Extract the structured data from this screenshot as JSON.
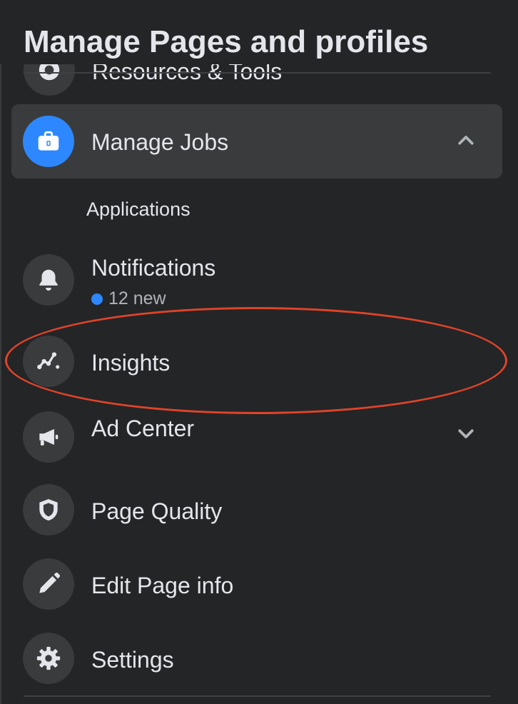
{
  "panel": {
    "title": "Manage Pages and profiles",
    "peek_item_label": "Resources & Tools"
  },
  "menu": {
    "manage_jobs": {
      "label": "Manage Jobs",
      "icon": "briefcase-icon",
      "expanded": true
    },
    "applications": {
      "label": "Applications"
    },
    "notifications": {
      "label": "Notifications",
      "badge": "12 new",
      "icon": "bell-icon"
    },
    "insights": {
      "label": "Insights",
      "icon": "insights-icon"
    },
    "ad_center": {
      "label": "Ad Center",
      "icon": "megaphone-icon",
      "expanded": false
    },
    "page_quality": {
      "label": "Page Quality",
      "icon": "shield-icon"
    },
    "edit_page_info": {
      "label": "Edit Page info",
      "icon": "pencil-icon"
    },
    "settings": {
      "label": "Settings",
      "icon": "gear-icon"
    }
  },
  "colors": {
    "background": "#242526",
    "item_highlight": "#3a3b3c",
    "accent": "#2d88ff",
    "annotation": "#e0432a"
  }
}
